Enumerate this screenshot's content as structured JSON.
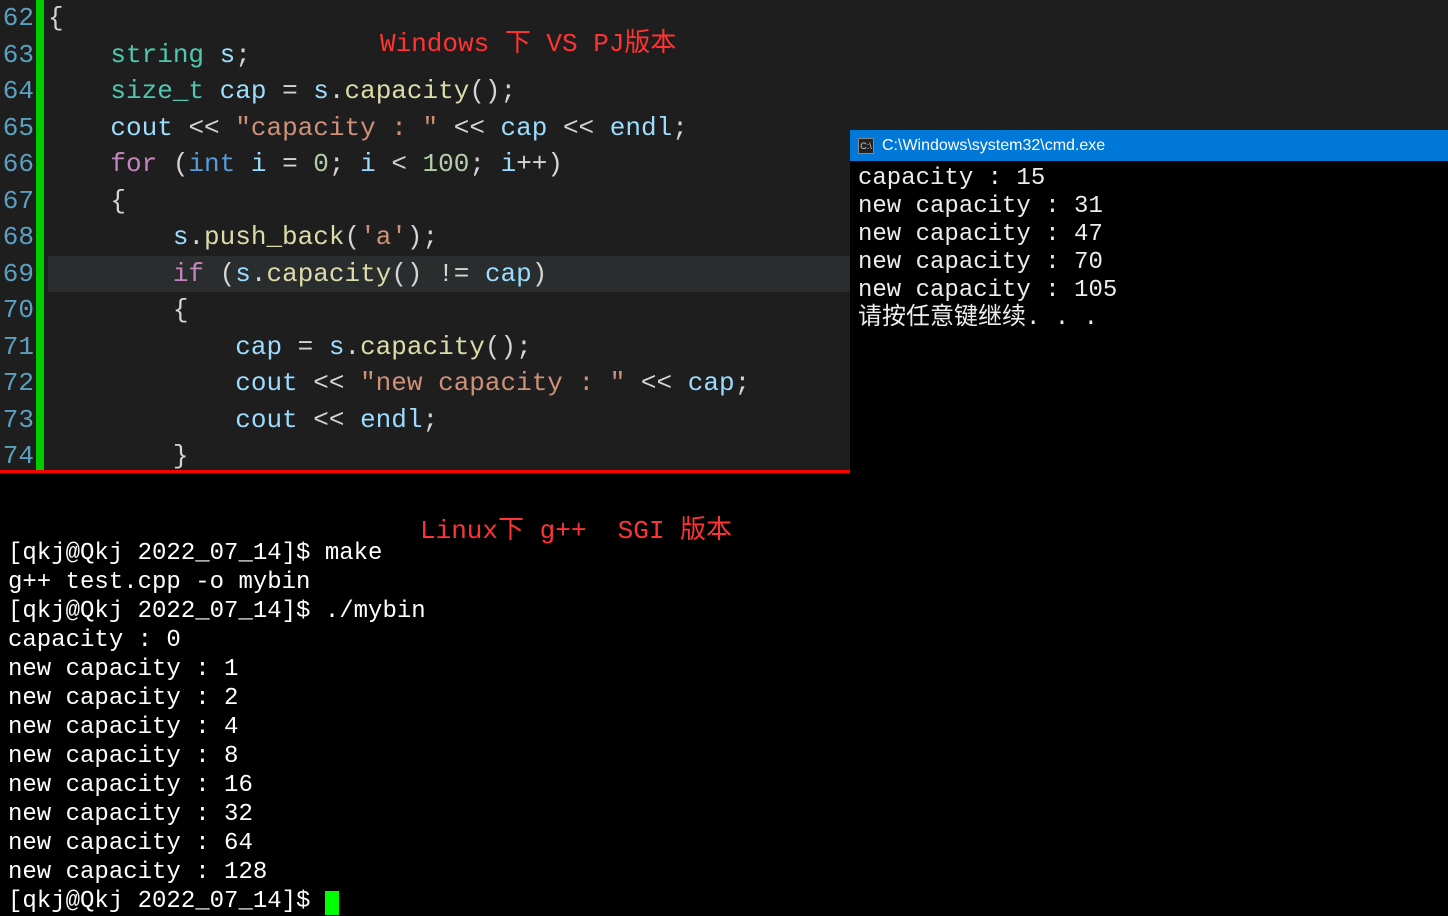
{
  "annotations": {
    "top": "Windows  下  VS   PJ版本",
    "bottom": "Linux下 g++  SGI 版本"
  },
  "editor": {
    "line_start": 62,
    "lines": [
      {
        "n": "62",
        "t": "{",
        "indent": 0
      },
      {
        "n": "63",
        "t": "string s;",
        "indent": 1,
        "html": "    <span class='k-teal'>string</span> <span class='k-var'>s</span>;"
      },
      {
        "n": "64",
        "t": "size_t cap = s.capacity();",
        "indent": 1,
        "html": "    <span class='k-teal'>size_t</span> <span class='k-var'>cap</span> = <span class='k-var'>s</span>.<span class='k-func'>capacity</span>();"
      },
      {
        "n": "65",
        "t": "cout << \"capacity : \" << cap << endl;",
        "indent": 1,
        "html": "    <span class='k-var'>cout</span> &lt;&lt; <span class='k-str'>\"capacity : \"</span> &lt;&lt; <span class='k-var'>cap</span> &lt;&lt; <span class='k-var'>endl</span>;"
      },
      {
        "n": "66",
        "t": "for (int i = 0; i < 100; i++)",
        "indent": 1,
        "html": "    <span class='k-mag'>for</span> (<span class='k-blue'>int</span> <span class='k-var'>i</span> = <span class='k-num'>0</span>; <span class='k-var'>i</span> &lt; <span class='k-num'>100</span>; <span class='k-var'>i</span>++)"
      },
      {
        "n": "67",
        "t": "{",
        "indent": 1,
        "html": "    {"
      },
      {
        "n": "68",
        "t": "s.push_back('a');",
        "indent": 2,
        "html": "        <span class='k-var'>s</span>.<span class='k-func'>push_back</span>(<span class='k-str'>'a'</span>);"
      },
      {
        "n": "69",
        "t": "if (s.capacity() != cap)",
        "indent": 2,
        "hl": true,
        "html": "        <span class='k-mag'>if</span> (<span class='k-var'>s</span>.<span class='k-func'>capacity</span>() != <span class='k-var'>cap</span>)"
      },
      {
        "n": "70",
        "t": "{",
        "indent": 2,
        "html": "        {"
      },
      {
        "n": "71",
        "t": "cap = s.capacity();",
        "indent": 3,
        "html": "            <span class='k-var'>cap</span> = <span class='k-var'>s</span>.<span class='k-func'>capacity</span>();"
      },
      {
        "n": "72",
        "t": "cout << \"new capacity : \" << cap;",
        "indent": 3,
        "html": "            <span class='k-var'>cout</span> &lt;&lt; <span class='k-str'>\"new capacity : \"</span> &lt;&lt; <span class='k-var'>cap</span>;"
      },
      {
        "n": "73",
        "t": "cout << endl;",
        "indent": 3,
        "html": "            <span class='k-var'>cout</span> &lt;&lt; <span class='k-var'>endl</span>;"
      },
      {
        "n": "74",
        "t": "}",
        "indent": 2,
        "html": "        }"
      }
    ]
  },
  "cmd": {
    "title": "C:\\Windows\\system32\\cmd.exe",
    "lines": [
      "capacity : 15",
      "new capacity : 31",
      "new capacity : 47",
      "new capacity : 70",
      "new capacity : 105",
      "请按任意键继续. . ."
    ]
  },
  "linux": {
    "lines": [
      "[qkj@Qkj 2022_07_14]$ make",
      "g++ test.cpp -o mybin",
      "[qkj@Qkj 2022_07_14]$ ./mybin",
      "capacity : 0",
      "new capacity : 1",
      "new capacity : 2",
      "new capacity : 4",
      "new capacity : 8",
      "new capacity : 16",
      "new capacity : 32",
      "new capacity : 64",
      "new capacity : 128",
      "[qkj@Qkj 2022_07_14]$ "
    ]
  }
}
